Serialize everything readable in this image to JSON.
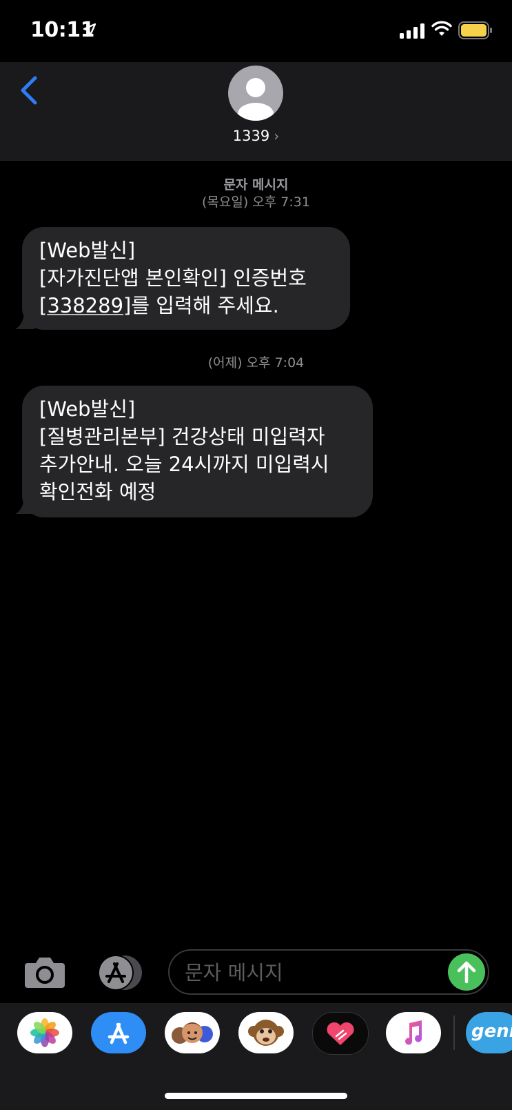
{
  "status_bar": {
    "time": "10:11"
  },
  "header": {
    "contact_name": "1339"
  },
  "thread": [
    {
      "type": "meta",
      "label": "문자 메시지",
      "date": "(목요일) 오후 7:31"
    },
    {
      "type": "message",
      "lines": [
        "[Web발신]",
        "[자가진단앱 본인확인] 인증번호"
      ],
      "code": "338289",
      "after_code": "를 입력해 주세요."
    },
    {
      "type": "meta",
      "date": "(어제) 오후 7:04"
    },
    {
      "type": "message",
      "lines": [
        "[Web발신]",
        "[질병관리본부] 건강상태 미입력자",
        "추가안내. 오늘 24시까지 미입력시",
        "확인전화 예정"
      ]
    }
  ],
  "composer": {
    "placeholder": "문자 메시지"
  },
  "dock": {
    "apps": [
      "photos-icon",
      "app-store-icon",
      "memoji-icon",
      "animoji-icon",
      "digital-touch-icon",
      "music-icon",
      "genie-icon"
    ],
    "genie_label": "genie"
  },
  "colors": {
    "accent_blue": "#2f7df6",
    "send_green": "#4ac05c",
    "bubble": "#262628"
  }
}
